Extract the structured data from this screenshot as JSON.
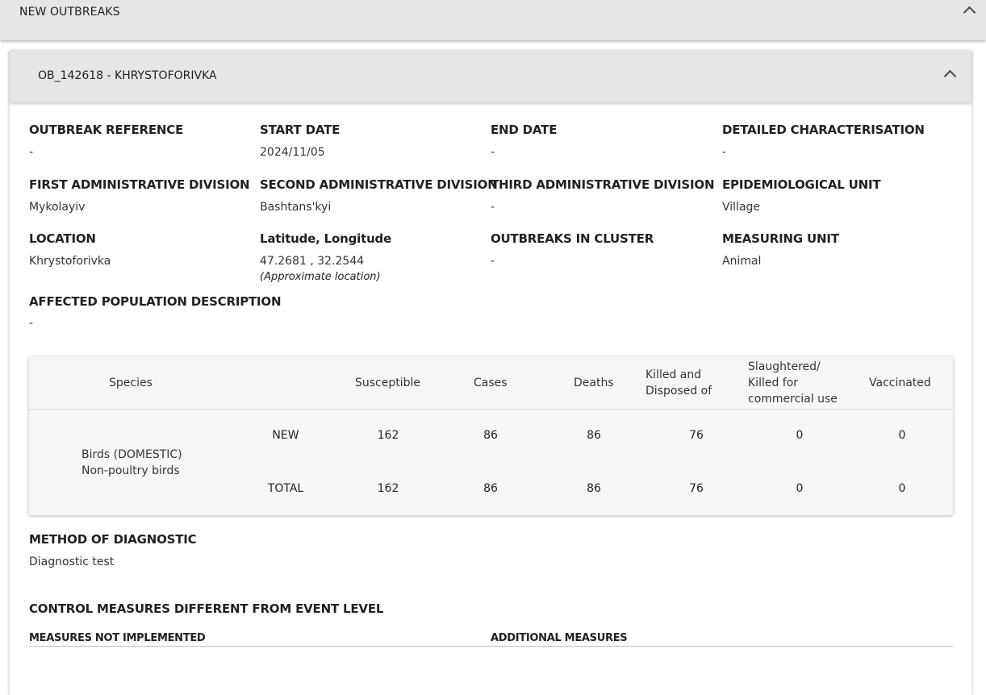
{
  "outer_panel": {
    "title": "NEW OUTBREAKS"
  },
  "outbreak_panel": {
    "title": "OB_142618 - KHRYSTOFORIVKA"
  },
  "fields": {
    "outbreak_reference": {
      "label": "OUTBREAK REFERENCE",
      "value": "-"
    },
    "start_date": {
      "label": "START DATE",
      "value": "2024/11/05"
    },
    "end_date": {
      "label": "END DATE",
      "value": "-"
    },
    "detailed_characterisation": {
      "label": "DETAILED CHARACTERISATION",
      "value": "-"
    },
    "first_admin_division": {
      "label": "FIRST ADMINISTRATIVE DIVISION",
      "value": "Mykolayiv"
    },
    "second_admin_division": {
      "label": "SECOND ADMINISTRATIVE DIVISION",
      "value": "Bashtans'kyi"
    },
    "third_admin_division": {
      "label": "THIRD ADMINISTRATIVE DIVISION",
      "value": "-"
    },
    "epidemiological_unit": {
      "label": "EPIDEMIOLOGICAL UNIT",
      "value": "Village"
    },
    "location": {
      "label": "LOCATION",
      "value": "Khrystoforivka"
    },
    "lat_long": {
      "label": "Latitude, Longitude",
      "value": "47.2681 , 32.2544",
      "note": "(Approximate location)"
    },
    "outbreaks_in_cluster": {
      "label": "OUTBREAKS IN CLUSTER",
      "value": "-"
    },
    "measuring_unit": {
      "label": "MEASURING UNIT",
      "value": "Animal"
    },
    "affected_population": {
      "label": "AFFECTED POPULATION DESCRIPTION",
      "value": "-"
    }
  },
  "species_table": {
    "headers": {
      "species": "Species",
      "susceptible": "Susceptible",
      "cases": "Cases",
      "deaths": "Deaths",
      "killed_disposed": [
        "Killed and",
        "Disposed of"
      ],
      "slaughtered": [
        "Slaughtered/",
        "Killed for",
        "commercial use"
      ],
      "vaccinated": "Vaccinated"
    },
    "species_name": [
      "Birds (DOMESTIC)",
      "Non-poultry birds"
    ],
    "rows": [
      {
        "type": "NEW",
        "susceptible": "162",
        "cases": "86",
        "deaths": "86",
        "killed_disposed": "76",
        "slaughtered": "0",
        "vaccinated": "0"
      },
      {
        "type": "TOTAL",
        "susceptible": "162",
        "cases": "86",
        "deaths": "86",
        "killed_disposed": "76",
        "slaughtered": "0",
        "vaccinated": "0"
      }
    ]
  },
  "diagnostic": {
    "label": "METHOD OF DIAGNOSTIC",
    "value": "Diagnostic test"
  },
  "control_measures": {
    "title": "CONTROL MEASURES DIFFERENT FROM EVENT LEVEL",
    "not_implemented_label": "MEASURES NOT IMPLEMENTED",
    "additional_label": "ADDITIONAL MEASURES"
  }
}
